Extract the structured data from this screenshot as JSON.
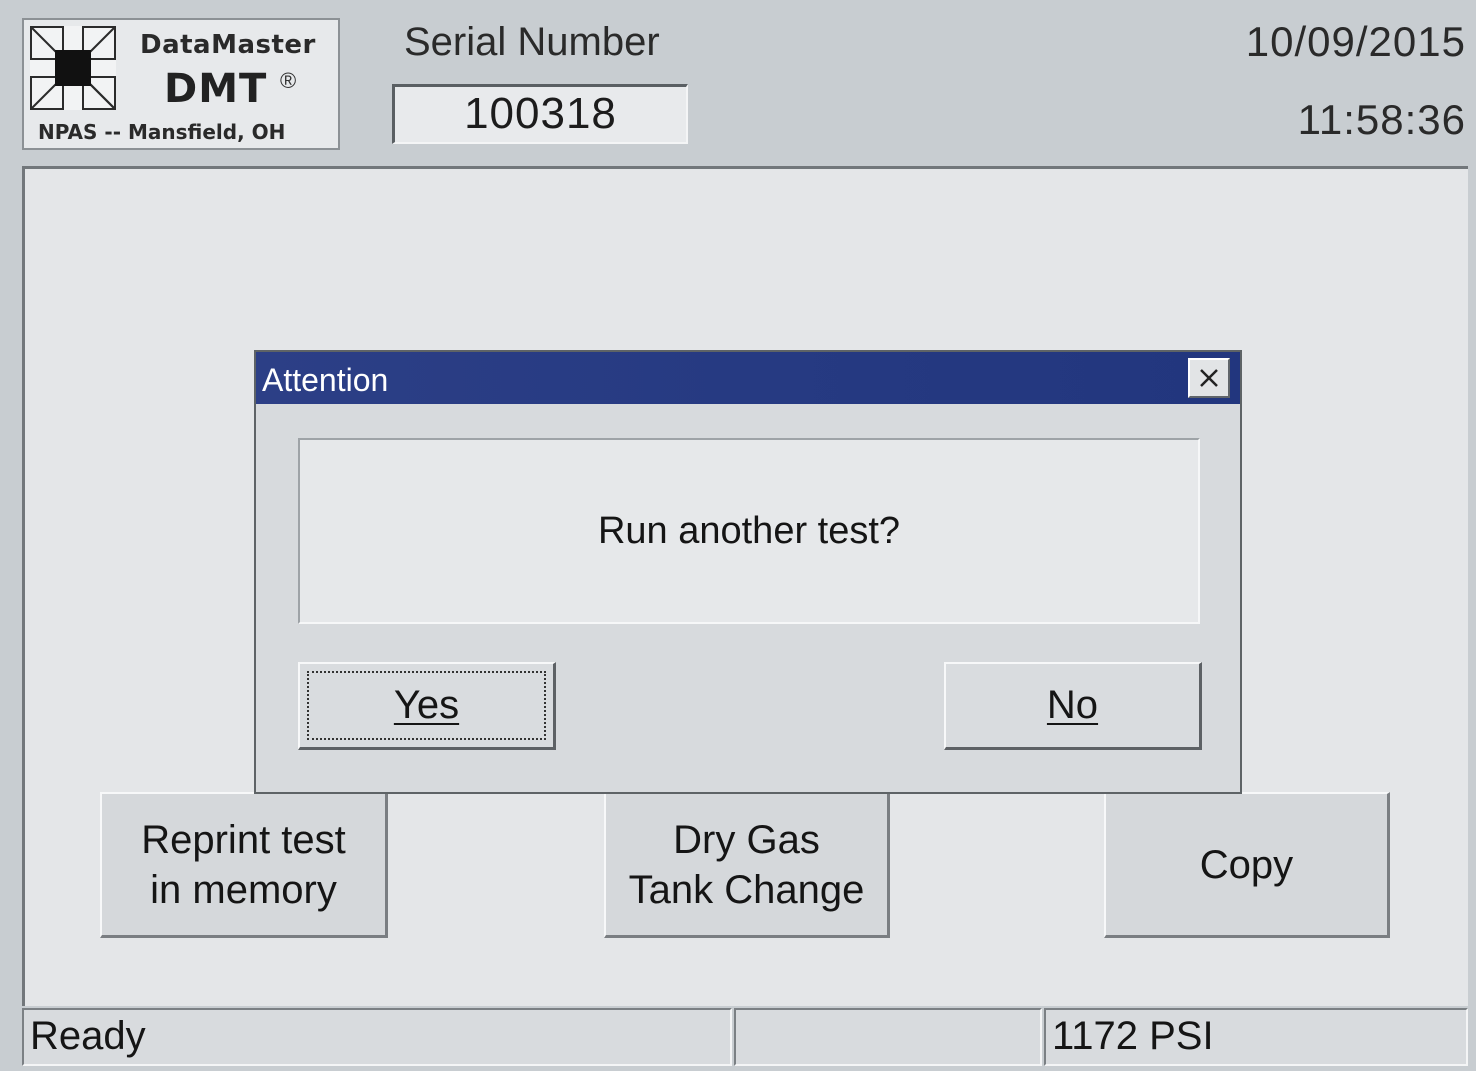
{
  "header": {
    "logo": {
      "brand": "DataMaster",
      "product": "DMT",
      "registered_mark": "®",
      "location": "NPAS -- Mansfield, OH"
    },
    "serial_label": "Serial Number",
    "serial_value": "100318",
    "date": "10/09/2015",
    "time": "11:58:36"
  },
  "dialog": {
    "title": "Attention",
    "close_icon": "close-icon",
    "message": "Run another test?",
    "yes_label": "Yes",
    "no_label": "No"
  },
  "actions": {
    "reprint_label": "Reprint test\nin memory",
    "drygas_label": "Dry Gas\nTank Change",
    "copy_label": "Copy"
  },
  "status_bar": {
    "status": "Ready",
    "middle": "",
    "pressure": "1172 PSI"
  },
  "colors": {
    "titlebar": "#263a82",
    "background": "#c8cdd1",
    "panel": "#e4e6e8",
    "button": "#d5d8db"
  }
}
